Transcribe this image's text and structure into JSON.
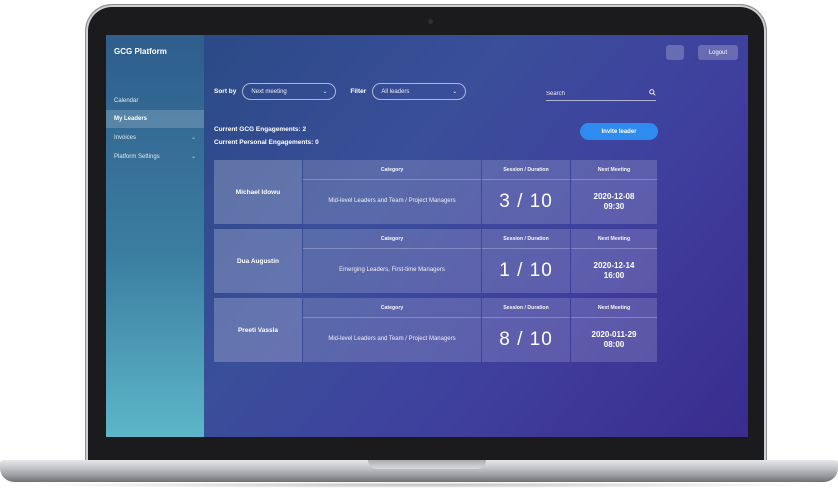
{
  "app": {
    "brand": "GCG Platform",
    "top_small_button": "",
    "logout_label": "Logout"
  },
  "sidebar": {
    "items": [
      {
        "label": "Calendar",
        "active": false,
        "chevron": ""
      },
      {
        "label": "My Leaders",
        "active": true,
        "chevron": ""
      },
      {
        "label": "Invoices",
        "active": false,
        "chevron": "⌄"
      },
      {
        "label": "Platform Settings",
        "active": false,
        "chevron": "⌄"
      }
    ]
  },
  "toolbar": {
    "sort_label": "Sort by",
    "sort_value": "Next meeting",
    "filter_label": "Filter",
    "filter_value": "All leaders",
    "search_placeholder": "Search"
  },
  "summary": {
    "gcg_engagements": "Current GCG Engagements: 2",
    "personal_engagements": "Current Personal Engagements: 0",
    "invite_label": "Invite leader"
  },
  "column_headers": {
    "category": "Category",
    "session": "Session / Duration",
    "next_meeting": "Next Meeting"
  },
  "leaders": [
    {
      "name": "Michael Idowu",
      "category": "Mid-level Leaders and Team / Project Managers",
      "session": "3 / 10",
      "next_date": "2020-12-08",
      "next_time": "09:30"
    },
    {
      "name": "Dua Augustin",
      "category": "Emerging Leaders, First-time Managers",
      "session": "1 / 10",
      "next_date": "2020-12-14",
      "next_time": "16:00"
    },
    {
      "name": "Preeti Vassla",
      "category": "Mid-level Leaders and Team / Project Managers",
      "session": "8 / 10",
      "next_date": "2020-011-29",
      "next_time": "08:00"
    }
  ],
  "icons": {
    "search": "search-icon",
    "chevron": "chevron-down-icon"
  }
}
